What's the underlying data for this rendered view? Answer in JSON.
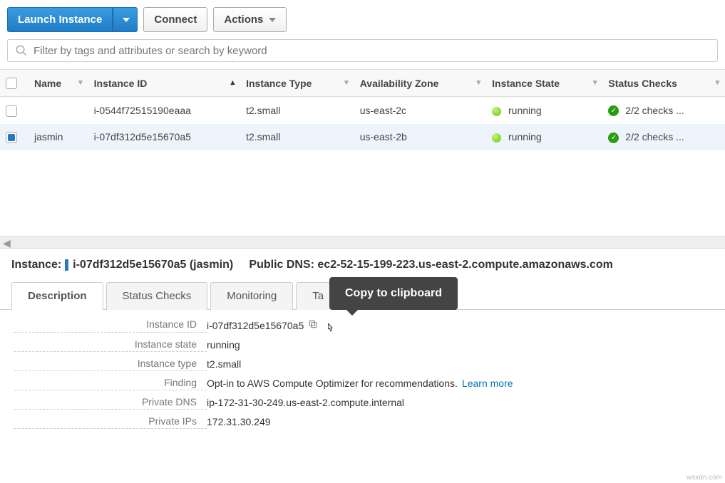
{
  "toolbar": {
    "launch_label": "Launch Instance",
    "connect_label": "Connect",
    "actions_label": "Actions"
  },
  "filter": {
    "placeholder": "Filter by tags and attributes or search by keyword"
  },
  "columns": {
    "name": "Name",
    "instance_id": "Instance ID",
    "instance_type": "Instance Type",
    "availability_zone": "Availability Zone",
    "instance_state": "Instance State",
    "status_checks": "Status Checks"
  },
  "rows": [
    {
      "selected": false,
      "name": "",
      "instance_id": "i-0544f72515190eaaa",
      "instance_type": "t2.small",
      "availability_zone": "us-east-2c",
      "instance_state": "running",
      "status_checks": "2/2 checks ..."
    },
    {
      "selected": true,
      "name": "jasmin",
      "instance_id": "i-07df312d5e15670a5",
      "instance_type": "t2.small",
      "availability_zone": "us-east-2b",
      "instance_state": "running",
      "status_checks": "2/2 checks ..."
    }
  ],
  "detail_header": {
    "instance_prefix": "Instance:",
    "instance_value": "i-07df312d5e15670a5 (jasmin)",
    "public_dns_prefix": "Public DNS:",
    "public_dns_value": "ec2-52-15-199-223.us-east-2.compute.amazonaws.com"
  },
  "tabs": {
    "description": "Description",
    "status_checks": "Status Checks",
    "monitoring": "Monitoring",
    "tags_prefix": "Ta"
  },
  "tooltip": {
    "copy": "Copy to clipboard"
  },
  "details": {
    "labels": {
      "instance_id": "Instance ID",
      "instance_state": "Instance state",
      "instance_type": "Instance type",
      "finding": "Finding",
      "private_dns": "Private DNS",
      "private_ips": "Private IPs"
    },
    "values": {
      "instance_id": "i-07df312d5e15670a5",
      "instance_state": "running",
      "instance_type": "t2.small",
      "finding_text": "Opt-in to AWS Compute Optimizer for recommendations. ",
      "finding_link": "Learn more",
      "private_dns": "ip-172-31-30-249.us-east-2.compute.internal",
      "private_ips": "172.31.30.249"
    }
  },
  "watermark": "wsxdn.com"
}
